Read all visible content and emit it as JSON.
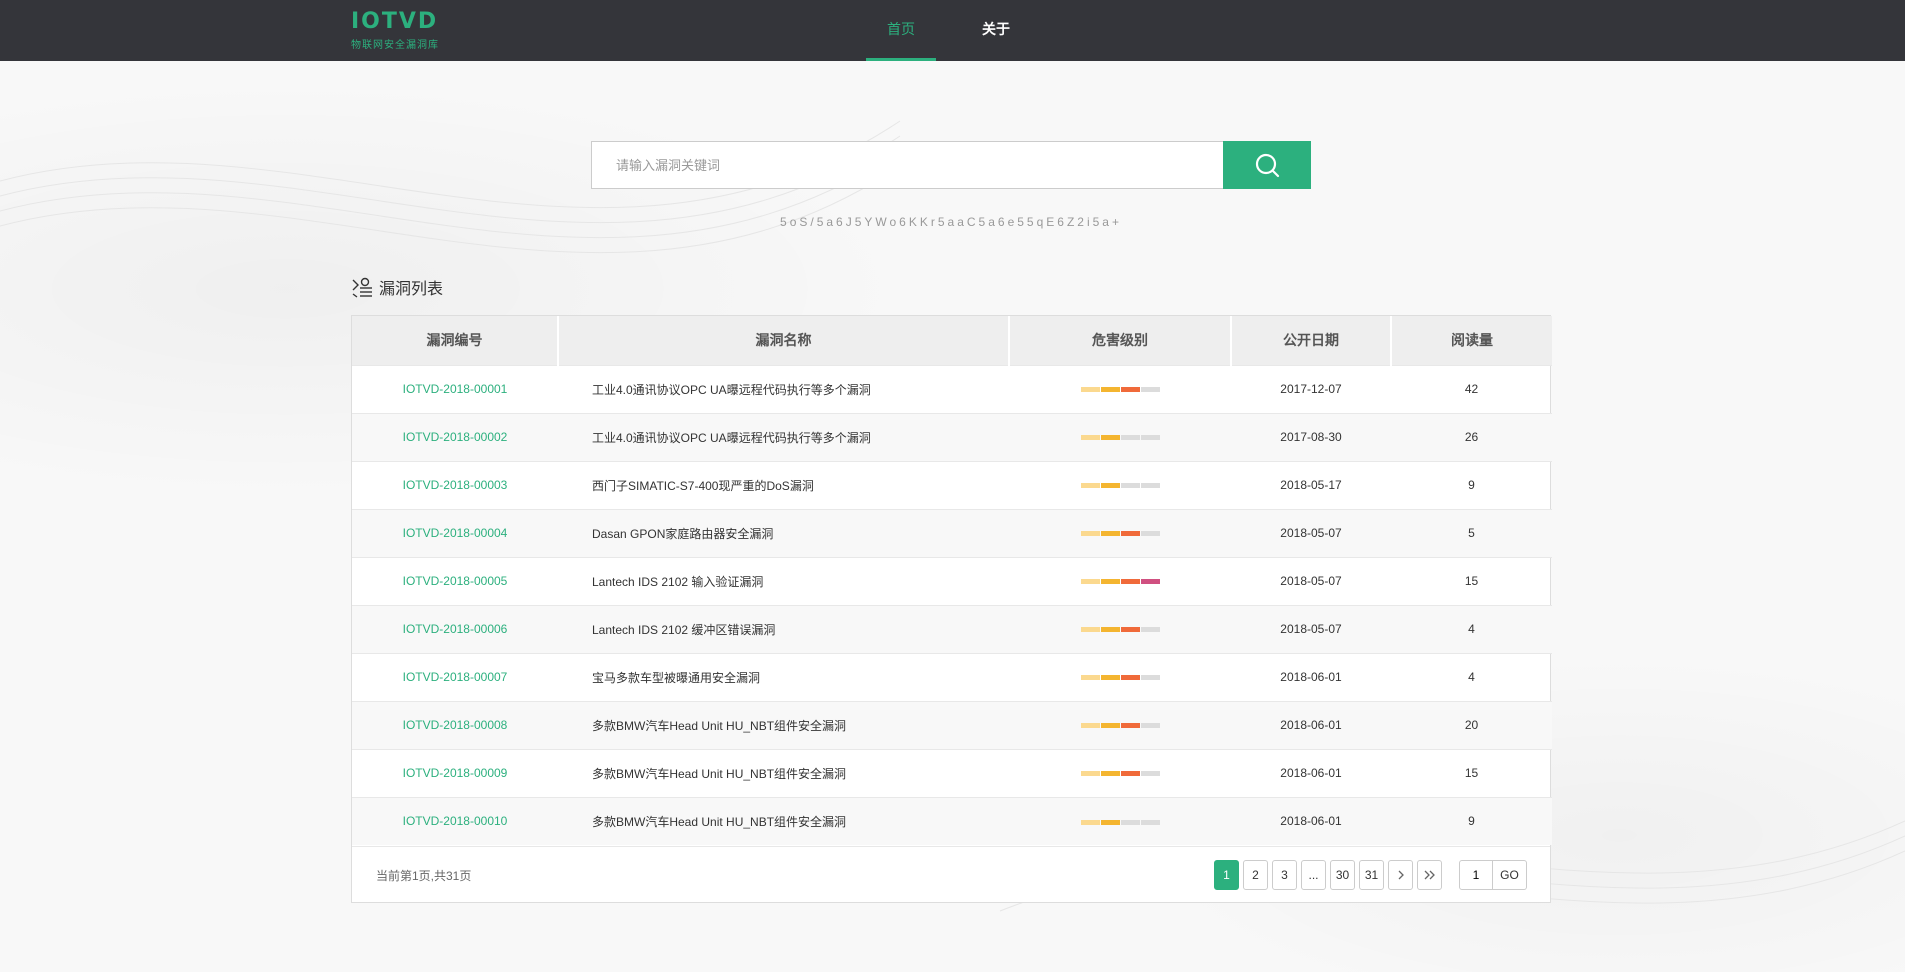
{
  "header": {
    "logo_main": "IOTVD",
    "logo_sub": "物联网安全漏洞库",
    "nav": [
      {
        "label": "首页",
        "active": true
      },
      {
        "label": "关于",
        "active": false
      }
    ]
  },
  "search": {
    "placeholder": "请输入漏洞关键词",
    "hint": "5oS/5a6J5YWo6KKr5aaC5a6e55qE6Z2i5a+"
  },
  "section": {
    "title": "漏洞列表"
  },
  "table": {
    "columns": [
      "漏洞编号",
      "漏洞名称",
      "危害级别",
      "公开日期",
      "阅读量"
    ],
    "level_colors": [
      "#fbd98f",
      "#f4b530",
      "#f06a3a",
      "#d05080"
    ],
    "level_empty_color": "#dcdcdc",
    "rows": [
      {
        "id": "IOTVD-2018-00001",
        "name": "工业4.0通讯协议OPC UA曝远程代码执行等多个漏洞",
        "level": 3,
        "date": "2017-12-07",
        "views": "42"
      },
      {
        "id": "IOTVD-2018-00002",
        "name": "工业4.0通讯协议OPC UA曝远程代码执行等多个漏洞",
        "level": 2,
        "date": "2017-08-30",
        "views": "26"
      },
      {
        "id": "IOTVD-2018-00003",
        "name": "西门子SIMATIC-S7-400现严重的DoS漏洞",
        "level": 2,
        "date": "2018-05-17",
        "views": "9"
      },
      {
        "id": "IOTVD-2018-00004",
        "name": "Dasan GPON家庭路由器安全漏洞",
        "level": 3,
        "date": "2018-05-07",
        "views": "5"
      },
      {
        "id": "IOTVD-2018-00005",
        "name": "Lantech IDS 2102 输入验证漏洞",
        "level": 4,
        "date": "2018-05-07",
        "views": "15"
      },
      {
        "id": "IOTVD-2018-00006",
        "name": "Lantech IDS 2102 缓冲区错误漏洞",
        "level": 3,
        "date": "2018-05-07",
        "views": "4"
      },
      {
        "id": "IOTVD-2018-00007",
        "name": "宝马多款车型被曝通用安全漏洞",
        "level": 3,
        "date": "2018-06-01",
        "views": "4"
      },
      {
        "id": "IOTVD-2018-00008",
        "name": "多款BMW汽车Head Unit HU_NBT组件安全漏洞",
        "level": 3,
        "date": "2018-06-01",
        "views": "20"
      },
      {
        "id": "IOTVD-2018-00009",
        "name": "多款BMW汽车Head Unit HU_NBT组件安全漏洞",
        "level": 3,
        "date": "2018-06-01",
        "views": "15"
      },
      {
        "id": "IOTVD-2018-00010",
        "name": "多款BMW汽车Head Unit HU_NBT组件安全漏洞",
        "level": 2,
        "date": "2018-06-01",
        "views": "9"
      }
    ]
  },
  "pagination": {
    "info": "当前第1页,共31页",
    "pages": [
      "1",
      "2",
      "3",
      "...",
      "30",
      "31"
    ],
    "active_page": "1",
    "jump_value": "1",
    "go_label": "GO"
  }
}
